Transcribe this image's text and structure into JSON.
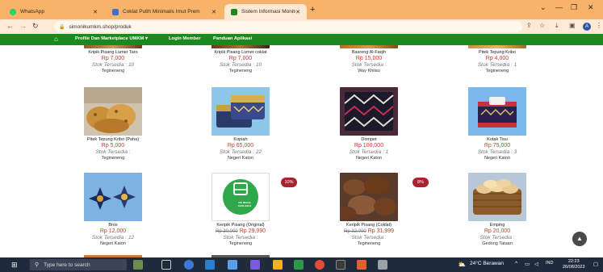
{
  "browser": {
    "tabs": [
      {
        "title": "WhatsApp",
        "favicon_color": "#25d366"
      },
      {
        "title": "Coklat Putih Minimalis Imut Prem",
        "favicon_color": "#3b6fd6"
      },
      {
        "title": "Sistem Informasi Monitoring Kin",
        "favicon_color": "#1a8a1f"
      }
    ],
    "new_tab": "+",
    "url": "simonikumkm.shop/produk"
  },
  "site_nav": {
    "items": [
      "Profile Dan Marketplace UMKM ▾",
      "Login Member",
      "Panduan Aplikasi"
    ]
  },
  "products": [
    {
      "name": "Kripik Pisang Lumer Taro",
      "price": "Rp 7,000",
      "old_price": "",
      "stock": "Stok Tersedia : 10",
      "location": "Tegineneng"
    },
    {
      "name": "Kripik Pisang Lumer coklat",
      "price": "Rp 7,000",
      "old_price": "",
      "stock": "Stok Tersedia : 10",
      "location": "Tegineneng"
    },
    {
      "name": "Basreng Al-Faqih",
      "price": "Rp 15,000",
      "old_price": "",
      "stock": "Stok Tersedia :",
      "location": "Way Khilau"
    },
    {
      "name": "Pitek Tepung Kribo",
      "price": "Rp 4,000",
      "old_price": "",
      "stock": "Stok Tersedia : 1",
      "location": "Tegineneng"
    },
    {
      "name": "Pitek Tepung Kribo (Paha)",
      "price": "Rp 5,000",
      "old_price": "",
      "stock": "Stok Tersedia :",
      "location": "Tegineneng"
    },
    {
      "name": "Kopiah",
      "price": "Rp 65,000",
      "old_price": "",
      "stock": "Stok Tersedia : 22",
      "location": "Negeri Katon"
    },
    {
      "name": "Dompet",
      "price": "Rp 100,000",
      "old_price": "",
      "stock": "Stok Tersedia : 1",
      "location": "Negeri Katon"
    },
    {
      "name": "Kotak Tisu",
      "price": "Rp 75,000",
      "old_price": "",
      "stock": "Stok Tersedia : 3",
      "location": "Negeri Katon"
    },
    {
      "name": "Bros",
      "price": "Rp 12,000",
      "old_price": "",
      "stock": "Stok Tersedia : 12",
      "location": "Negeri Katon"
    },
    {
      "name": "Keripik Pisang (Original)",
      "price": "Rp 29,990",
      "old_price": "Rp 30,000",
      "stock": "Stok Tersedia :",
      "location": "Tegineneng",
      "badge": "10%",
      "image_label": "NO IMAGE AVAILABLE"
    },
    {
      "name": "Keripik Pisang (Coklat)",
      "price": "Rp 31,999",
      "old_price": "Rp 32,000",
      "stock": "Stok Tersedia :",
      "location": "Tegineneng",
      "badge": "8%"
    },
    {
      "name": "Emping",
      "price": "Rp 20,000",
      "old_price": "",
      "stock": "Stok Tersedia :",
      "location": "Gedong Tataan"
    }
  ],
  "taskbar": {
    "search_placeholder": "Type here to search",
    "weather": "24°C Berawan",
    "lang": "IND",
    "time": "22:23",
    "date": "26/08/2023"
  },
  "colors": {
    "tab_strip": "#f7b36a",
    "site_nav": "#1a8a1f",
    "price": "#e03030",
    "badge": "#a8232f"
  }
}
